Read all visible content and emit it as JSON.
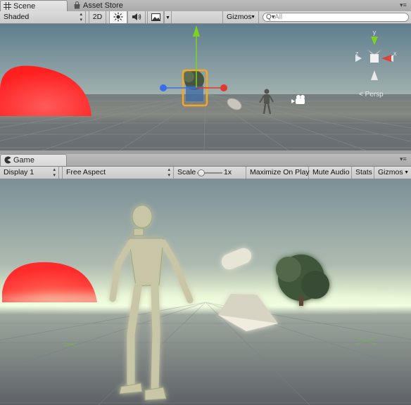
{
  "scene_window": {
    "tabs": [
      {
        "label": "Scene",
        "active": true,
        "icon": "grid-icon"
      },
      {
        "label": "Asset Store",
        "active": false,
        "icon": "shopping-bag-icon"
      }
    ],
    "toolbar": {
      "draw_mode": "Shaded",
      "mode_2d": "2D",
      "lighting_icon": "sun-icon",
      "audio_icon": "speaker-icon",
      "effects_icon": "image-icon",
      "gizmos_label": "Gizmos",
      "search_placeholder": "All",
      "search_prefix": "Q▾"
    },
    "view_gizmo_label": "Persp",
    "view_gizmo_axes": [
      "y",
      "x",
      "z"
    ]
  },
  "game_window": {
    "tabs": [
      {
        "label": "Game",
        "active": true,
        "icon": "pacman-icon"
      }
    ],
    "toolbar": {
      "display": "Display 1",
      "aspect": "Free Aspect",
      "scale_label": "Scale",
      "scale_value": "1x",
      "scale_fraction": 0.05,
      "maximize_on_play": "Maximize On Play",
      "mute_audio": "Mute Audio",
      "stats": "Stats",
      "gizmos": "Gizmos"
    }
  },
  "colors": {
    "sun": "#ff2b2b",
    "x_axis": "#e3392b",
    "y_axis": "#7ed321",
    "z_axis": "#3a6ee8",
    "selection": "#f5a623",
    "glow": "#c9ff9a"
  }
}
